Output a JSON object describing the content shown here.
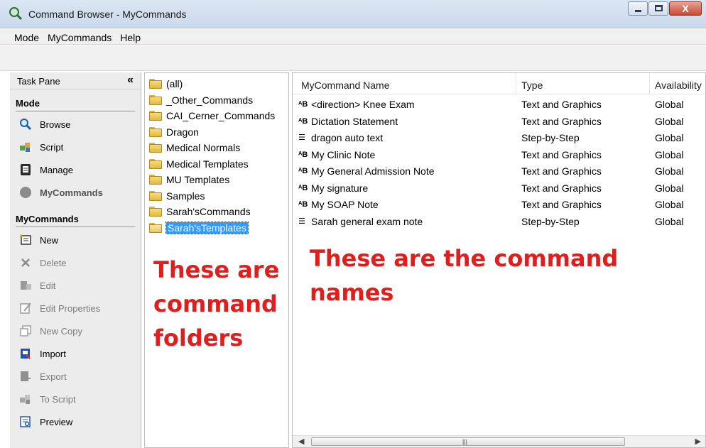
{
  "window": {
    "title": "Command Browser - MyCommands",
    "close_glyph": "X"
  },
  "menu": [
    "Mode",
    "MyCommands",
    "Help"
  ],
  "taskpane": {
    "title": "Task Pane",
    "collapse_glyph": "«",
    "mode_section": "Mode",
    "mode_items": [
      "Browse",
      "Script",
      "Manage",
      "MyCommands"
    ],
    "mycommands_section": "MyCommands",
    "mycommands_items": [
      "New",
      "Delete",
      "Edit",
      "Edit Properties",
      "New Copy",
      "Import",
      "Export",
      "To Script",
      "Preview"
    ]
  },
  "folders": [
    "(all)",
    "_Other_Commands",
    "CAI_Cerner_Commands",
    "Dragon",
    "Medical Normals",
    "Medical Templates",
    "MU Templates",
    "Samples",
    "Sarah'sCommands",
    "Sarah'sTemplates"
  ],
  "selected_folder": "Sarah'sTemplates",
  "list": {
    "columns": [
      "MyCommand Name",
      "Type",
      "Availability"
    ],
    "rows": [
      {
        "name": "<direction> Knee Exam",
        "type": "Text and Graphics",
        "availability": "Global",
        "icon": "text-graphics-icon"
      },
      {
        "name": "Dictation Statement",
        "type": "Text and Graphics",
        "availability": "Global",
        "icon": "text-graphics-icon"
      },
      {
        "name": "dragon auto text",
        "type": "Step-by-Step",
        "availability": "Global",
        "icon": "step-list-icon"
      },
      {
        "name": "My Clinic Note",
        "type": "Text and Graphics",
        "availability": "Global",
        "icon": "text-graphics-icon"
      },
      {
        "name": "My General Admission Note",
        "type": "Text and Graphics",
        "availability": "Global",
        "icon": "text-graphics-icon"
      },
      {
        "name": "My signature",
        "type": "Text and Graphics",
        "availability": "Global",
        "icon": "text-graphics-icon"
      },
      {
        "name": "My SOAP Note",
        "type": "Text and Graphics",
        "availability": "Global",
        "icon": "text-graphics-icon"
      },
      {
        "name": "Sarah general exam note",
        "type": "Step-by-Step",
        "availability": "Global",
        "icon": "step-list-icon"
      }
    ]
  },
  "annotations": {
    "folders_note": [
      "These are",
      "command",
      "folders"
    ],
    "names_note": [
      "These are the command",
      "names"
    ]
  },
  "colors": {
    "annotation": "#e01e1e",
    "selection": "#3399ff"
  }
}
